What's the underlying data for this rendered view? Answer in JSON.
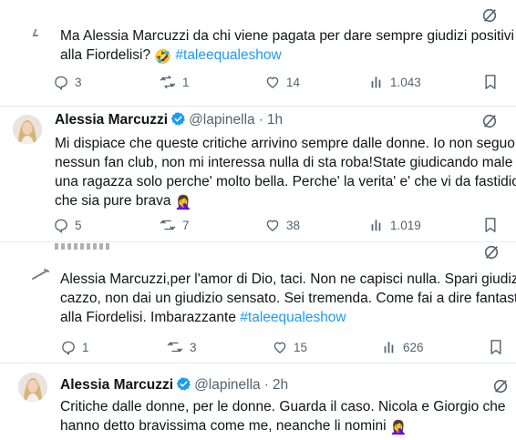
{
  "tweets": [
    {
      "text_line1": "Ma Alessia Marcuzzi da chi viene pagata per dare sempre giudizi positivi",
      "text_line2_prefix": "alla Fiordelisi? ",
      "text_line2_emoji": "🤣",
      "text_line2_hashtag": "#taleequaleshow",
      "replies": "3",
      "retweets": "1",
      "likes": "14",
      "views": "1.043"
    },
    {
      "name": "Alessia Marcuzzi",
      "handle": "@lapinella",
      "time": "1h",
      "lines": [
        "Mi dispiace che queste critiche arrivino sempre dalle donne. Io non seguo",
        "nessun fan club, non mi interessa nulla di sta roba!State giudicando male",
        "una ragazza solo perche' molto bella. Perche' la verita' e' che vi da fastidio",
        "che sia pure brava"
      ],
      "emoji": "🤦‍♀️",
      "replies": "5",
      "retweets": "7",
      "likes": "38",
      "views": "1.019"
    },
    {
      "lines": [
        "Alessia Marcuzzi,per l'amor di Dio, taci. Non ne capisci nulla. Spari giudizi",
        "cazzo, non dai un giudizio sensato. Sei tremenda. Come fai a dire fantasti"
      ],
      "line3_prefix": "alla Fiordelisi. Imbarazzante ",
      "line3_hashtag": "#taleequaleshow",
      "replies": "1",
      "retweets": "3",
      "likes": "15",
      "views": "626"
    },
    {
      "name": "Alessia Marcuzzi",
      "handle": "@lapinella",
      "time": "2h",
      "lines": [
        "Critiche dalle donne, per le donne. Guarda il caso. Nicola e Giorgio che",
        "hanno detto bravissima come me, neanche li nomini"
      ],
      "emoji": "🤦‍♀️"
    }
  ],
  "separator": "·",
  "colors": {
    "text": "#0f1419",
    "secondary": "#536471",
    "link": "#1d9bf0",
    "verified": "#1d9bf0"
  },
  "icons": [
    "grok-icon",
    "reply-icon",
    "retweet-icon",
    "like-icon",
    "views-icon",
    "bookmark-icon",
    "verified-badge-icon"
  ]
}
